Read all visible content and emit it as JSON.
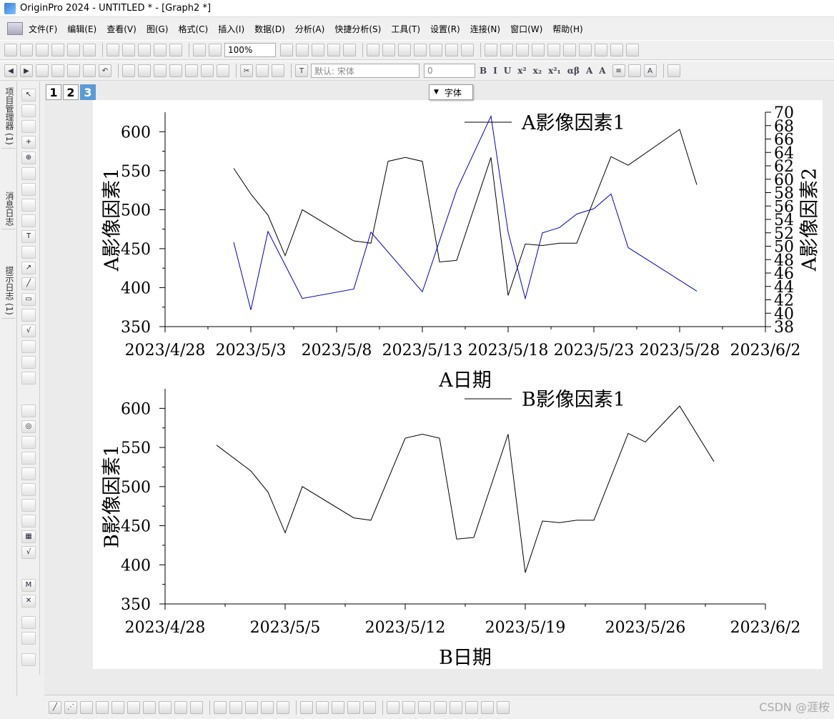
{
  "window": {
    "title": "OriginPro 2024 - UNTITLED * - [Graph2 *]"
  },
  "menu": [
    "文件(F)",
    "编辑(E)",
    "查看(V)",
    "图(G)",
    "格式(C)",
    "插入(I)",
    "数据(D)",
    "分析(A)",
    "快捷分析(S)",
    "工具(T)",
    "设置(R)",
    "连接(N)",
    "窗口(W)",
    "帮助(H)"
  ],
  "toolbar": {
    "zoom": "100%",
    "font_name": "默认: 宋体",
    "font_size": "0",
    "format_buttons": [
      "B",
      "I",
      "U",
      "x²",
      "x₂",
      "x²₁",
      "αβ",
      "A",
      "A"
    ]
  },
  "sidebar_tabs": [
    "项目管理器 (1)",
    "消息日志",
    "提示日志 (1)"
  ],
  "layer_tabs": [
    "1",
    "2",
    "3"
  ],
  "tooltip": {
    "label": "字体"
  },
  "watermark": "CSDN @涯桉",
  "chart_data": [
    {
      "type": "line",
      "xlabel": "A日期",
      "ylabel": "A影像因素1",
      "y2label": "A影像因素2",
      "legend": "A影像因素1",
      "xlim": [
        "2023-04-28",
        "2023-06-02"
      ],
      "ylim": [
        350,
        625
      ],
      "y2lim": [
        38,
        70
      ],
      "x_ticks": [
        "2023/4/28",
        "2023/5/3",
        "2023/5/8",
        "2023/5/13",
        "2023/5/18",
        "2023/5/23",
        "2023/5/28",
        "2023/6/2"
      ],
      "y_ticks": [
        350,
        400,
        450,
        500,
        550,
        600
      ],
      "y2_ticks": [
        38,
        40,
        42,
        44,
        46,
        48,
        50,
        52,
        54,
        56,
        58,
        60,
        62,
        64,
        66,
        68,
        70
      ],
      "series": [
        {
          "name": "A影像因素1",
          "axis": "left",
          "color": "#000000",
          "x": [
            "2023-05-02",
            "2023-05-03",
            "2023-05-04",
            "2023-05-05",
            "2023-05-06",
            "2023-05-09",
            "2023-05-10",
            "2023-05-11",
            "2023-05-12",
            "2023-05-13",
            "2023-05-14",
            "2023-05-15",
            "2023-05-17",
            "2023-05-18",
            "2023-05-19",
            "2023-05-20",
            "2023-05-21",
            "2023-05-22",
            "2023-05-24",
            "2023-05-25",
            "2023-05-28",
            "2023-05-29"
          ],
          "y": [
            553,
            520,
            493,
            441,
            500,
            460,
            457,
            562,
            567,
            562,
            433,
            435,
            567,
            390,
            456,
            454,
            457,
            457,
            568,
            557,
            603,
            532
          ]
        },
        {
          "name": "A影像因素2",
          "axis": "right",
          "color": "#0000cc",
          "x": [
            "2023-05-02",
            "2023-05-03",
            "2023-05-04",
            "2023-05-06",
            "2023-05-09",
            "2023-05-10",
            "2023-05-13",
            "2023-05-15",
            "2023-05-17",
            "2023-05-18",
            "2023-05-19",
            "2023-05-20",
            "2023-05-21",
            "2023-05-22",
            "2023-05-23",
            "2023-05-24",
            "2023-05-25",
            "2023-05-29"
          ],
          "y": [
            50.6,
            40.5,
            52.2,
            42.2,
            43.6,
            52.1,
            43.2,
            58.4,
            69.4,
            52.1,
            42.2,
            52.0,
            52.8,
            54.8,
            55.6,
            57.8,
            49.8,
            43.3
          ]
        }
      ]
    },
    {
      "type": "line",
      "xlabel": "B日期",
      "ylabel": "B影像因素1",
      "legend": "B影像因素1",
      "xlim": [
        "2023-04-28",
        "2023-06-02"
      ],
      "ylim": [
        350,
        625
      ],
      "x_ticks": [
        "2023/4/28",
        "2023/5/5",
        "2023/5/12",
        "2023/5/19",
        "2023/5/26",
        "2023/6/2"
      ],
      "y_ticks": [
        350,
        400,
        450,
        500,
        550,
        600
      ],
      "series": [
        {
          "name": "B影像因素1",
          "axis": "left",
          "color": "#000000",
          "x": [
            "2023-05-01",
            "2023-05-03",
            "2023-05-04",
            "2023-05-05",
            "2023-05-06",
            "2023-05-09",
            "2023-05-10",
            "2023-05-12",
            "2023-05-13",
            "2023-05-14",
            "2023-05-15",
            "2023-05-16",
            "2023-05-18",
            "2023-05-19",
            "2023-05-20",
            "2023-05-21",
            "2023-05-22",
            "2023-05-23",
            "2023-05-25",
            "2023-05-26",
            "2023-05-28",
            "2023-05-30"
          ],
          "y": [
            553,
            520,
            493,
            441,
            500,
            460,
            457,
            562,
            567,
            562,
            433,
            435,
            567,
            390,
            456,
            454,
            457,
            457,
            568,
            557,
            603,
            532
          ]
        }
      ]
    }
  ]
}
